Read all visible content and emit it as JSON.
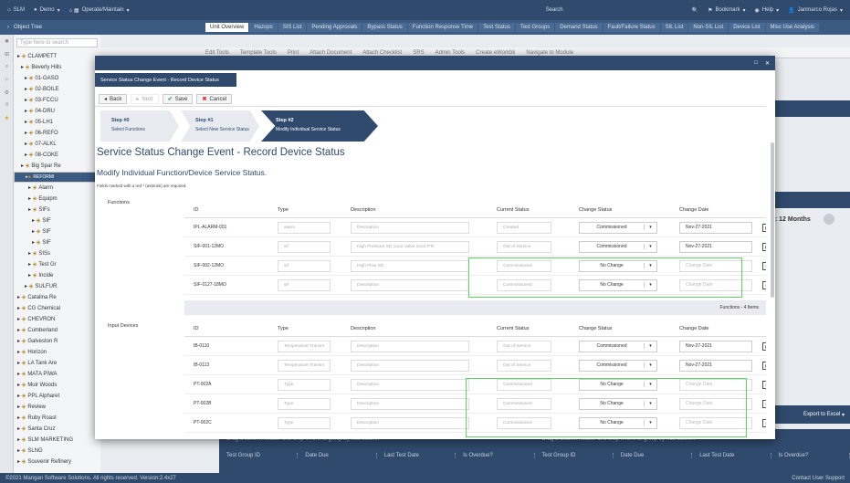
{
  "topbar": {
    "items": [
      "SLM",
      "Demo",
      "Operate/Maintain"
    ],
    "search": "Search",
    "bookmark": "Bookmark",
    "help": "Help",
    "user": "Janmarco Rojas"
  },
  "object_tree": {
    "title": "Object Tree",
    "search_placeholder": "Type here to search",
    "nodes": [
      {
        "label": "CLAMPETT",
        "indent": 4,
        "sel": false
      },
      {
        "label": "Beverly Hills",
        "indent": 8,
        "sel": false
      },
      {
        "label": "01-GASO",
        "indent": 12,
        "sel": false
      },
      {
        "label": "02-BOILE",
        "indent": 12,
        "sel": false
      },
      {
        "label": "03-FCCU",
        "indent": 12,
        "sel": false
      },
      {
        "label": "04-DRU",
        "indent": 12,
        "sel": false
      },
      {
        "label": "05-LH1",
        "indent": 12,
        "sel": false
      },
      {
        "label": "06-REFO",
        "indent": 12,
        "sel": false
      },
      {
        "label": "07-ALKL",
        "indent": 12,
        "sel": false
      },
      {
        "label": "08-COKE",
        "indent": 12,
        "sel": false
      },
      {
        "label": "Big Spar Re",
        "indent": 8,
        "sel": false
      },
      {
        "label": "REFORMI",
        "indent": 12,
        "sel": true
      },
      {
        "label": "Alarm",
        "indent": 16,
        "sel": false
      },
      {
        "label": "Equipm",
        "indent": 16,
        "sel": false
      },
      {
        "label": "SIFs",
        "indent": 16,
        "sel": false
      },
      {
        "label": "SIF",
        "indent": 20,
        "sel": false
      },
      {
        "label": "SIF",
        "indent": 20,
        "sel": false
      },
      {
        "label": "SIF",
        "indent": 20,
        "sel": false
      },
      {
        "label": "SISs",
        "indent": 16,
        "sel": false
      },
      {
        "label": "Test Gr",
        "indent": 16,
        "sel": false
      },
      {
        "label": "Incide",
        "indent": 16,
        "sel": false
      },
      {
        "label": "SULFUR",
        "indent": 12,
        "sel": false
      },
      {
        "label": "Catalina Re",
        "indent": 4,
        "sel": false
      },
      {
        "label": "CG Chemical",
        "indent": 4,
        "sel": false
      },
      {
        "label": "CHEVRON",
        "indent": 4,
        "sel": false
      },
      {
        "label": "Cumberland",
        "indent": 4,
        "sel": false
      },
      {
        "label": "Galveston R",
        "indent": 4,
        "sel": false
      },
      {
        "label": "Horizon",
        "indent": 4,
        "sel": false
      },
      {
        "label": "LA Tank Are",
        "indent": 4,
        "sel": false
      },
      {
        "label": "MATA PIWA",
        "indent": 4,
        "sel": false
      },
      {
        "label": "Muir Woods",
        "indent": 4,
        "sel": false
      },
      {
        "label": "PPL Alpharet",
        "indent": 4,
        "sel": false
      },
      {
        "label": "Review",
        "indent": 4,
        "sel": false
      },
      {
        "label": "Ruby Roast",
        "indent": 4,
        "sel": false
      },
      {
        "label": "Santa Cruz",
        "indent": 4,
        "sel": false
      },
      {
        "label": "SLM MARKETING",
        "indent": 4,
        "sel": false
      },
      {
        "label": "SLNG",
        "indent": 4,
        "sel": false
      },
      {
        "label": "Souvenir Refinery",
        "indent": 4,
        "sel": false
      }
    ]
  },
  "tabs": [
    "Unit Overview",
    "Hazops",
    "SIS List",
    "Pending Approvals",
    "Bypass Status",
    "Function Response Time",
    "Test Status",
    "Test Groups",
    "Demand Status",
    "Fault/Failure Status",
    "SIL List",
    "Non-SIL List",
    "Device List",
    "Misc Use Analysis"
  ],
  "bg_toolbar": [
    "Edit Tools",
    "Template Tools",
    "Print",
    "Attach Document",
    "Attach Checklist",
    "SRS",
    "Admin Tools",
    "Create eWorkbk",
    "Navigate to Module"
  ],
  "bg": {
    "months": "1: 12 Months",
    "export": "Export to Excel",
    "drag_hint": "Drag a column header and drop it here to group by that column",
    "cols": [
      "Test Group ID",
      "Date Due",
      "Last Test Date",
      "Is Overdue?",
      "Test Group ID",
      "Date Due",
      "Last Test Date",
      "Is Overdue?"
    ]
  },
  "footer": {
    "copyright": "©2021 Mangan Software Solutions. All rights reserved. Version:2.4x27",
    "contact": "Contact User Support"
  },
  "modal": {
    "close": "✕",
    "restore": "□",
    "header_tab": "Service Status Change Event - Record Device Status",
    "actions": {
      "back": "Back",
      "next": "Next",
      "save": "Save",
      "cancel": "Cancel"
    },
    "steps": [
      {
        "title": "Step #0",
        "sub": "Select Functions"
      },
      {
        "title": "Step #1",
        "sub": "Select New Service Status"
      },
      {
        "title": "Step #2",
        "sub": "Modify Individual Service Status"
      }
    ],
    "title": "Service Status Change Event - Record Device Status",
    "subtitle": "Modify Individual Function/Device Service Status.",
    "required_note": "Fields marked with a red * (asterisk) are required.",
    "functions": {
      "label": "Functions",
      "headers": [
        "ID",
        "Type",
        "Description",
        "Current Status",
        "Change Status",
        "Change Date"
      ],
      "rows": [
        {
          "id": "IPL-ALARM-001",
          "type": "alarm",
          "desc": "Description",
          "current": "Created",
          "change": "Commissioned",
          "date": "Nov-27-2021",
          "date_ph": false
        },
        {
          "id": "SIF-001-12MO",
          "type": "sif",
          "desc": "High Pressure SD 1oo2 Valve 2oo3 PTs",
          "current": "Out of Service",
          "change": "Commissioned",
          "date": "Nov-27-2021",
          "date_ph": false
        },
        {
          "id": "SIF-002-12MO",
          "type": "sif",
          "desc": "High Flow SD",
          "current": "Commissioned",
          "change": "No Change",
          "date": "Change Date",
          "date_ph": true
        },
        {
          "id": "SIF-0127-18MO",
          "type": "sif",
          "desc": "Description",
          "current": "Commissioned",
          "change": "No Change",
          "date": "Change Date",
          "date_ph": true
        }
      ],
      "footer": "Functions - 4 Items"
    },
    "devices": {
      "label": "Input Devices",
      "headers": [
        "ID",
        "Type",
        "Description",
        "Current Status",
        "Change Status",
        "Change Date"
      ],
      "rows": [
        {
          "id": "IB-0110",
          "type": "Temperature Transm",
          "desc": "Description",
          "current": "Out of Service",
          "change": "Commissioned",
          "date": "Nov-27-2021",
          "date_ph": false
        },
        {
          "id": "IB-0113",
          "type": "Temperature Transm",
          "desc": "Description",
          "current": "Out of Service",
          "change": "Commissioned",
          "date": "Nov-27-2021",
          "date_ph": false
        },
        {
          "id": "PT-002A",
          "type": "Type",
          "desc": "Description",
          "current": "Commissioned",
          "change": "No Change",
          "date": "Change Date",
          "date_ph": true
        },
        {
          "id": "PT-002B",
          "type": "Type",
          "desc": "Description",
          "current": "Commissioned",
          "change": "No Change",
          "date": "Change Date",
          "date_ph": true
        },
        {
          "id": "PT-002C",
          "type": "Type",
          "desc": "Description",
          "current": "Commissioned",
          "change": "No Change",
          "date": "Change Date",
          "date_ph": true
        }
      ]
    }
  },
  "colors": {
    "navy": "#2f4a6d",
    "highlight": "#5fd35f",
    "save_check": "#3a9d3a",
    "cancel_x": "#d33"
  }
}
